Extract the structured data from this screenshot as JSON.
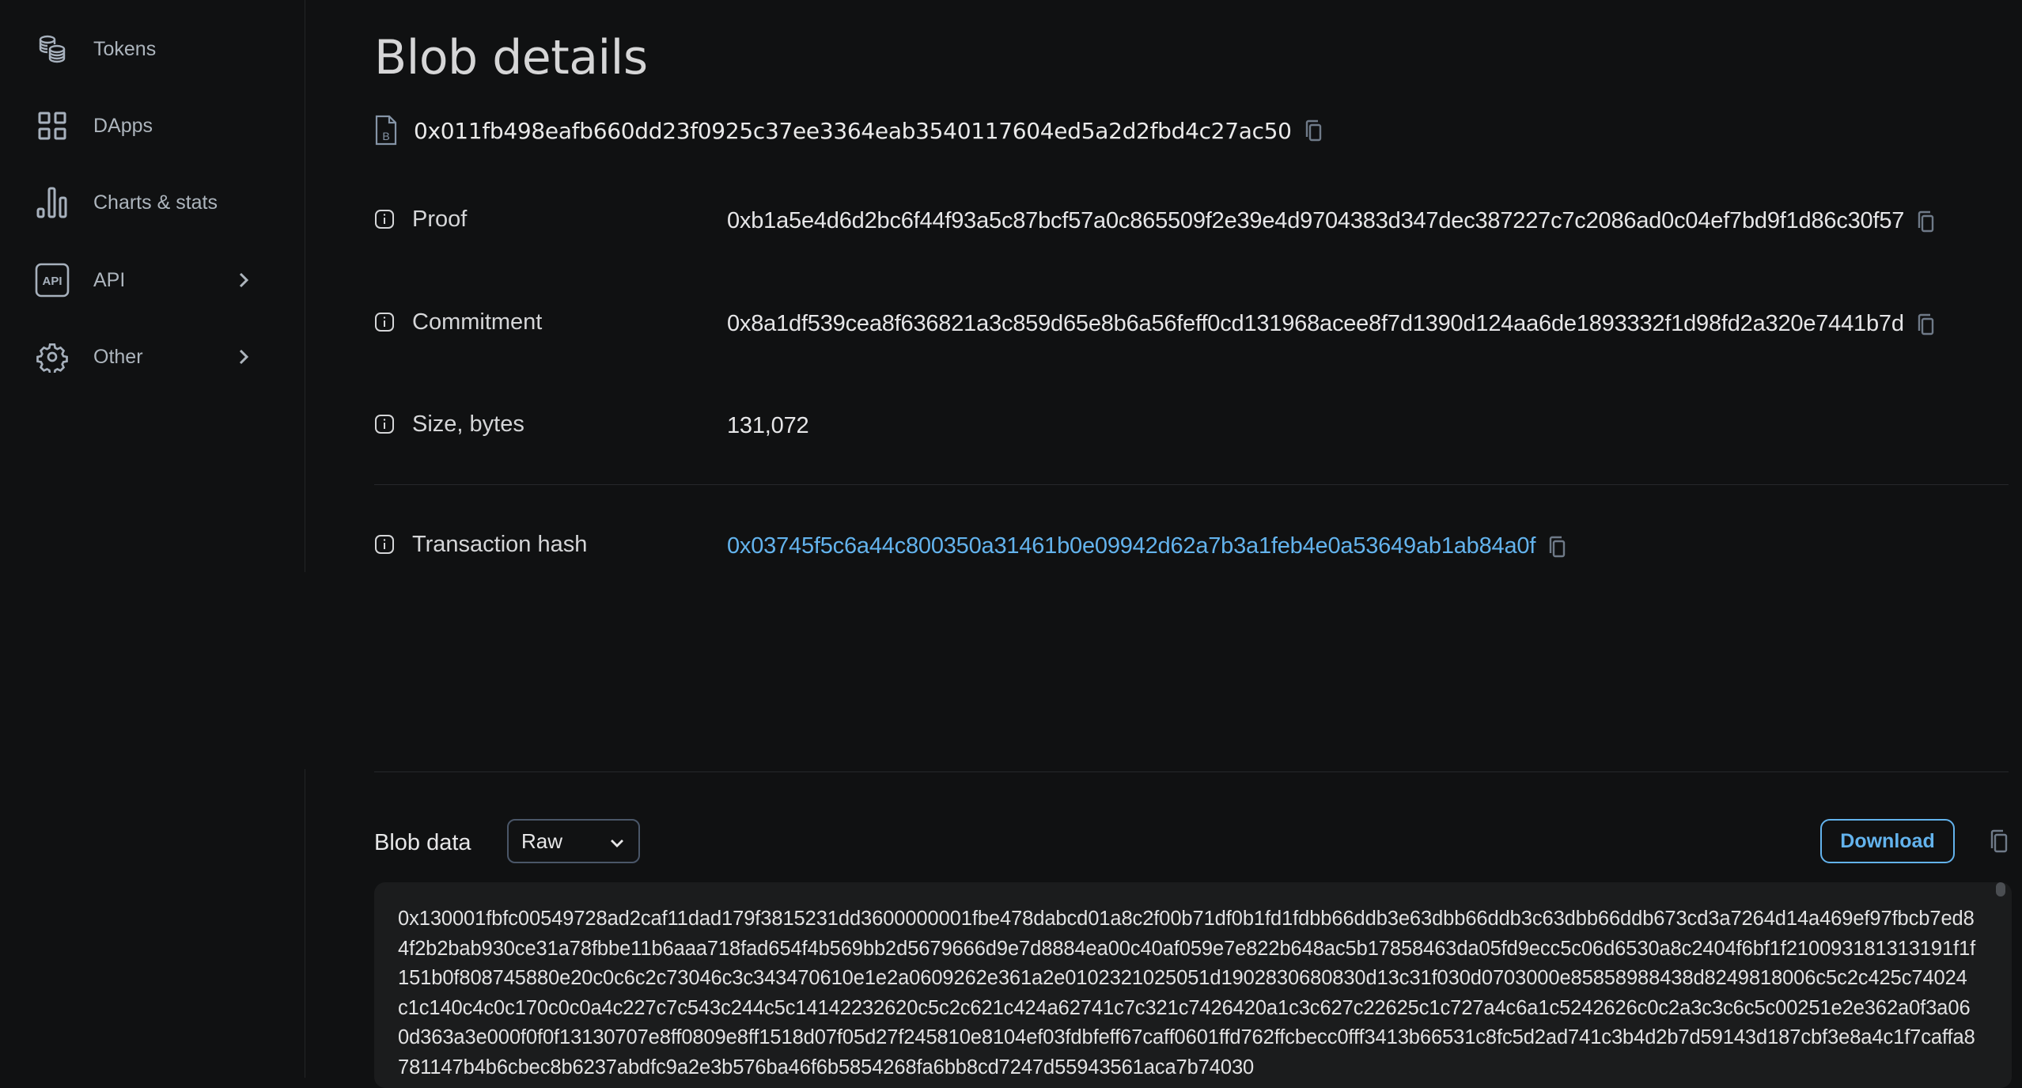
{
  "sidebar": {
    "items": [
      {
        "label": "Tokens",
        "icon": "coins-icon",
        "has_submenu": false
      },
      {
        "label": "DApps",
        "icon": "grid-icon",
        "has_submenu": false
      },
      {
        "label": "Charts & stats",
        "icon": "bar-chart-icon",
        "has_submenu": false
      },
      {
        "label": "API",
        "icon": "api-icon",
        "has_submenu": true
      },
      {
        "label": "Other",
        "icon": "gear-icon",
        "has_submenu": true
      }
    ]
  },
  "page": {
    "title": "Blob details",
    "blob_hash": "0x011fb498eafb660dd23f0925c37ee3364eab3540117604ed5a2d2fbd4c27ac50"
  },
  "details": {
    "proof": {
      "label": "Proof",
      "value": "0xb1a5e4d6d2bc6f44f93a5c87bcf57a0c865509f2e39e4d9704383d347dec387227c7c2086ad0c04ef7bd9f1d86c30f57"
    },
    "commitment": {
      "label": "Commitment",
      "value": "0x8a1df539cea8f636821a3c859d65e8b6a56feff0cd131968acee8f7d1390d124aa6de1893332f1d98fd2a320e7441b7d"
    },
    "size": {
      "label": "Size, bytes",
      "value": "131,072"
    },
    "transaction_hash": {
      "label": "Transaction hash",
      "value": "0x03745f5c6a44c800350a31461b0e09942d62a7b3a1feb4e0a53649ab1ab84a0f"
    }
  },
  "blob_data": {
    "label": "Blob data",
    "format_selected": "Raw",
    "download_label": "Download",
    "content": "0x130001fbfc00549728ad2caf11dad179f3815231dd3600000001fbe478dabcd01a8c2f00b71df0b1fd1fdbb66ddb3e63dbb66ddb3c63dbb66ddb673cd3a7264d14a469ef97fbcb7ed84f2b2bab930ce31a78fbbe11b6aaa718fad654f4b569bb2d5679666d9e7d8884ea00c40af059e7e822b648ac5b17858463da05fd9ecc5c06d6530a8c2404f6bf1f21009318131319 1f1f151b0f808745880e20c0c6c2c73046c3c343470610e1e2a0609262e361a2e0102321025051d1902830680830d13c31f030d0703000e85858988438d8249818006c5c2c425c74024c1c140c4c0c170c0c0a4c227c7c543c244c5c14142232620c5c2c621c424a62741c7c321c7426420a1c3c627c22625c1c727a4c6a1c5242626c0c2a3c3c6c5c00251e2e362a0f3a060d363a3e000f0f0f13130707e8ff0809e8ff1518d07f05d27f245810e8104ef03fdbfeff67caff0601ffd762ffcbecc0fff3413b66531c8fc5d2ad741c3b4d2b7d59143d187cbf3e8a4c1f7caffa8781147b4b6cbec8b6237abdfc9a2e3b576ba46f6b5854268fa6bb8cd7247d55943561aca7b74030"
  }
}
